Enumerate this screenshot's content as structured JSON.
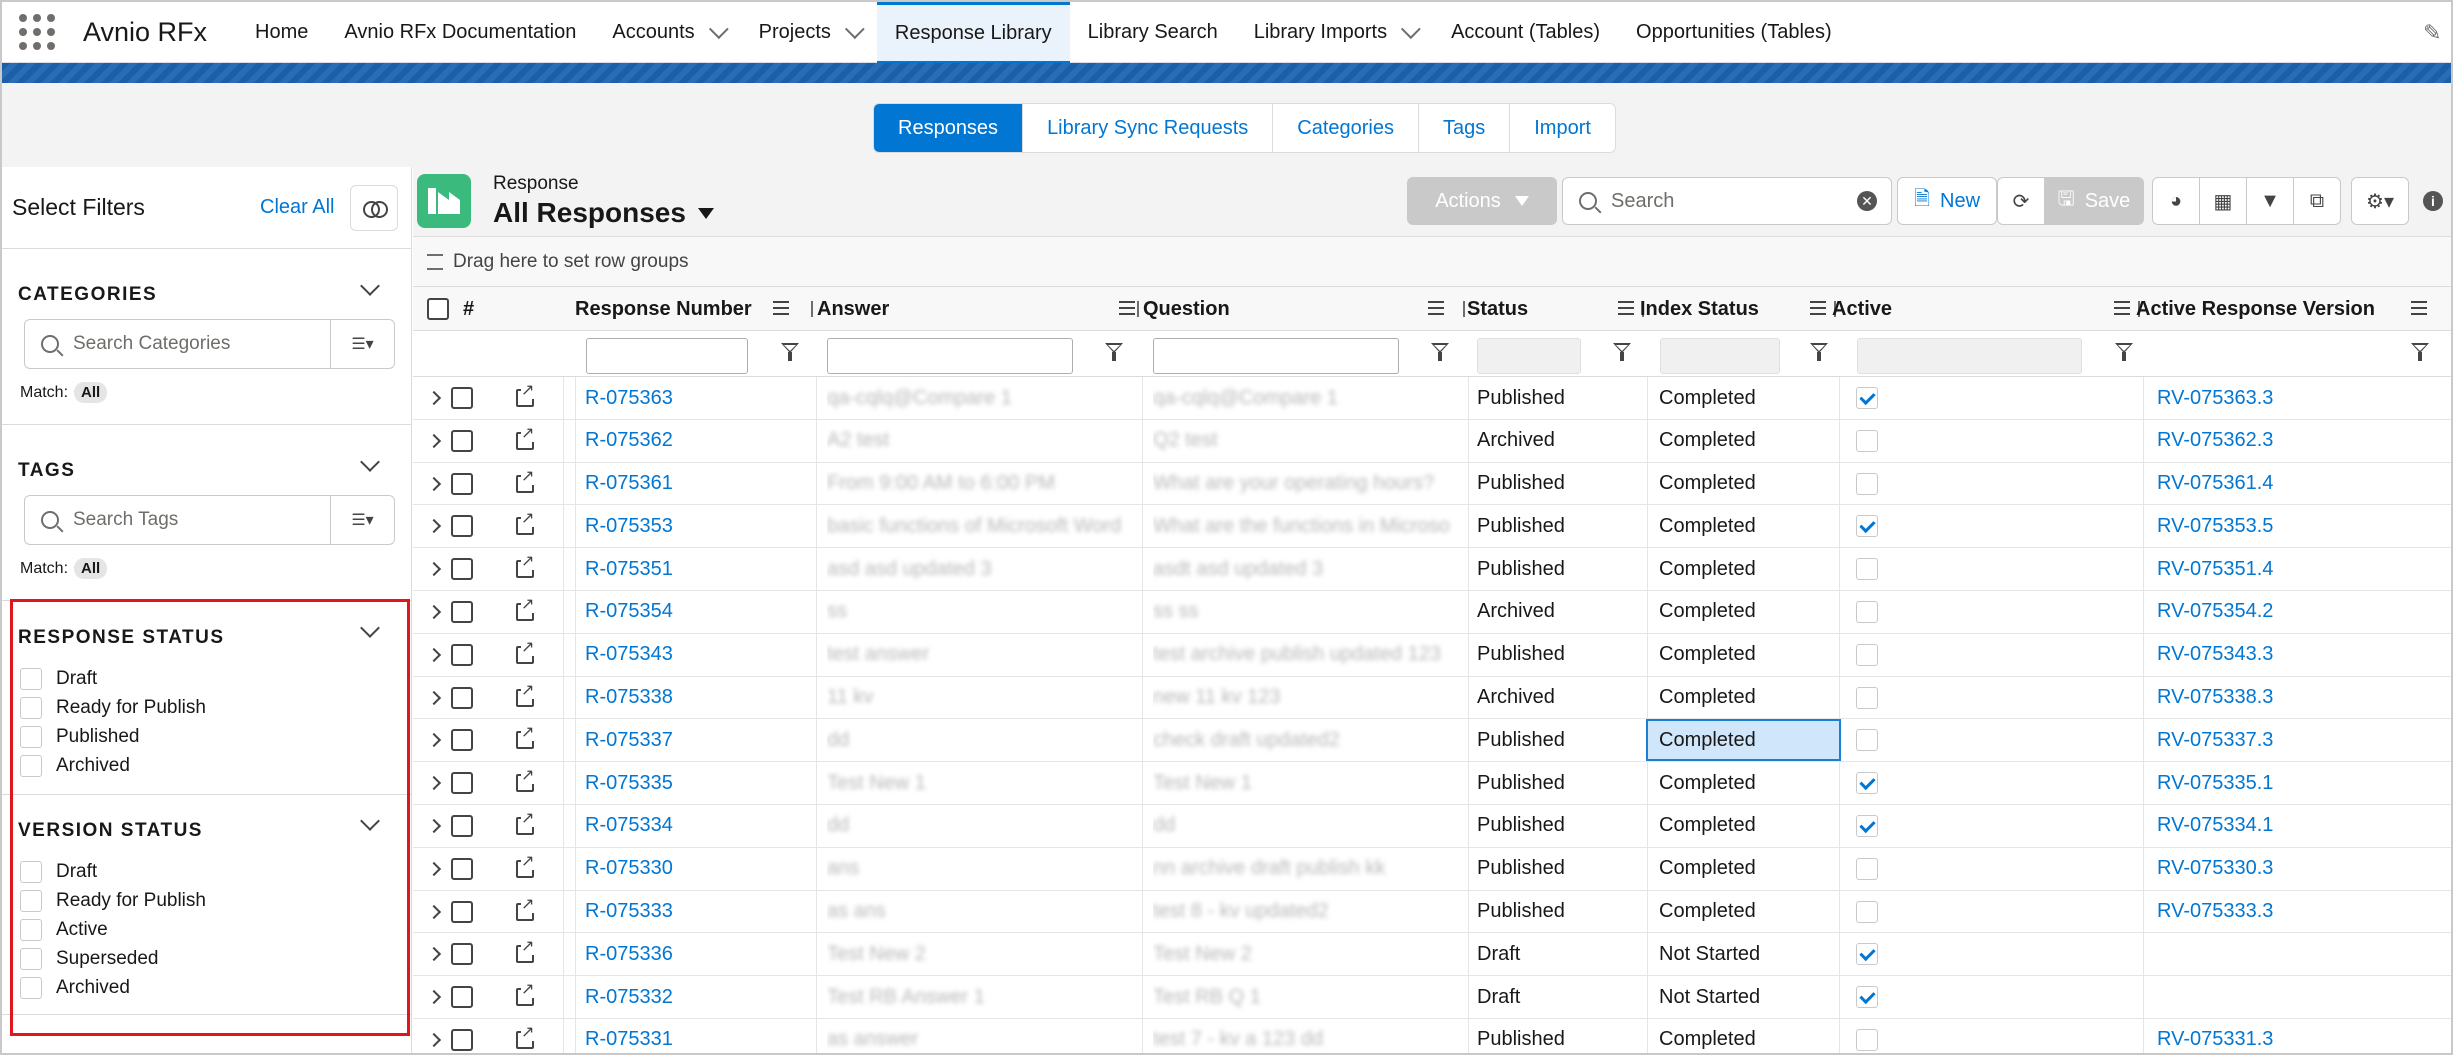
{
  "app": {
    "name": "Avnio RFx"
  },
  "nav": {
    "items": [
      {
        "label": "Home",
        "dropdown": false,
        "active": false
      },
      {
        "label": "Avnio RFx Documentation",
        "dropdown": false,
        "active": false
      },
      {
        "label": "Accounts",
        "dropdown": true,
        "active": false
      },
      {
        "label": "Projects",
        "dropdown": true,
        "active": false
      },
      {
        "label": "Response Library",
        "dropdown": false,
        "active": true
      },
      {
        "label": "Library Search",
        "dropdown": false,
        "active": false
      },
      {
        "label": "Library Imports",
        "dropdown": true,
        "active": false
      },
      {
        "label": "Account (Tables)",
        "dropdown": false,
        "active": false
      },
      {
        "label": "Opportunities (Tables)",
        "dropdown": false,
        "active": false
      }
    ]
  },
  "tabs": [
    {
      "label": "Responses",
      "active": true
    },
    {
      "label": "Library Sync Requests",
      "active": false
    },
    {
      "label": "Categories",
      "active": false
    },
    {
      "label": "Tags",
      "active": false
    },
    {
      "label": "Import",
      "active": false
    }
  ],
  "filters": {
    "title": "Select Filters",
    "clear_all": "Clear All",
    "categories": {
      "title": "CATEGORIES",
      "placeholder": "Search Categories",
      "match_label": "Match:",
      "match_value": "All"
    },
    "tags": {
      "title": "TAGS",
      "placeholder": "Search Tags",
      "match_label": "Match:",
      "match_value": "All"
    },
    "response_status": {
      "title": "RESPONSE STATUS",
      "options": [
        "Draft",
        "Ready for Publish",
        "Published",
        "Archived"
      ]
    },
    "version_status": {
      "title": "VERSION STATUS",
      "options": [
        "Draft",
        "Ready for Publish",
        "Active",
        "Superseded",
        "Archived"
      ]
    }
  },
  "grid": {
    "object_label": "Response",
    "list_name": "All Responses",
    "actions_label": "Actions",
    "search_placeholder": "Search",
    "new_label": "New",
    "save_label": "Save",
    "group_hint": "Drag here to set row groups",
    "columns": {
      "number": "#",
      "response_number": "Response Number",
      "answer": "Answer",
      "question": "Question",
      "status": "Status",
      "index_status": "Index Status",
      "active": "Active",
      "active_version": "Active Response Version"
    },
    "rows": [
      {
        "num": "R-075363",
        "answer": "qa-cqlq@Compare 1",
        "question": "qa-cqlq@Compare 1",
        "status": "Published",
        "index": "Completed",
        "active": true,
        "version": "RV-075363.3"
      },
      {
        "num": "R-075362",
        "answer": "A2 test",
        "question": "Q2 test",
        "status": "Archived",
        "index": "Completed",
        "active": false,
        "version": "RV-075362.3"
      },
      {
        "num": "R-075361",
        "answer": "From 9:00 AM to 6:00 PM",
        "question": "What are your operating hours?",
        "status": "Published",
        "index": "Completed",
        "active": false,
        "version": "RV-075361.4"
      },
      {
        "num": "R-075353",
        "answer": "basic functions of Microsoft Word",
        "question": "What are the functions in Microso",
        "status": "Published",
        "index": "Completed",
        "active": true,
        "version": "RV-075353.5"
      },
      {
        "num": "R-075351",
        "answer": "asd asd updated 3",
        "question": "asdt asd updated 3",
        "status": "Published",
        "index": "Completed",
        "active": false,
        "version": "RV-075351.4"
      },
      {
        "num": "R-075354",
        "answer": "ss",
        "question": "ss ss",
        "status": "Archived",
        "index": "Completed",
        "active": false,
        "version": "RV-075354.2"
      },
      {
        "num": "R-075343",
        "answer": "test answer",
        "question": "test archive publish updated 123",
        "status": "Published",
        "index": "Completed",
        "active": false,
        "version": "RV-075343.3"
      },
      {
        "num": "R-075338",
        "answer": "11 kv",
        "question": "new 11 kv 123",
        "status": "Archived",
        "index": "Completed",
        "active": false,
        "version": "RV-075338.3"
      },
      {
        "num": "R-075337",
        "answer": "dd",
        "question": "check draft updated2",
        "status": "Published",
        "index": "Completed",
        "active": false,
        "version": "RV-075337.3",
        "selected": true
      },
      {
        "num": "R-075335",
        "answer": "Test New 1",
        "question": "Test New 1",
        "status": "Published",
        "index": "Completed",
        "active": true,
        "version": "RV-075335.1"
      },
      {
        "num": "R-075334",
        "answer": "dd",
        "question": "dd",
        "status": "Published",
        "index": "Completed",
        "active": true,
        "version": "RV-075334.1"
      },
      {
        "num": "R-075330",
        "answer": "ans",
        "question": "nn archive draft publish kk",
        "status": "Published",
        "index": "Completed",
        "active": false,
        "version": "RV-075330.3"
      },
      {
        "num": "R-075333",
        "answer": "as ans",
        "question": "test 8 - kv updated2",
        "status": "Published",
        "index": "Completed",
        "active": false,
        "version": "RV-075333.3"
      },
      {
        "num": "R-075336",
        "answer": "Test New 2",
        "question": "Test New 2",
        "status": "Draft",
        "index": "Not Started",
        "active": true,
        "version": ""
      },
      {
        "num": "R-075332",
        "answer": "Test RB Answer 1",
        "question": "Test RB Q 1",
        "status": "Draft",
        "index": "Not Started",
        "active": true,
        "version": ""
      },
      {
        "num": "R-075331",
        "answer": "as answer",
        "question": "test 7 - kv a 123 dd",
        "status": "Published",
        "index": "Completed",
        "active": false,
        "version": "RV-075331.3"
      }
    ]
  },
  "colors": {
    "brand": "#0176d3",
    "highlight": "#e0161c",
    "object_icon": "#3bba7d"
  }
}
